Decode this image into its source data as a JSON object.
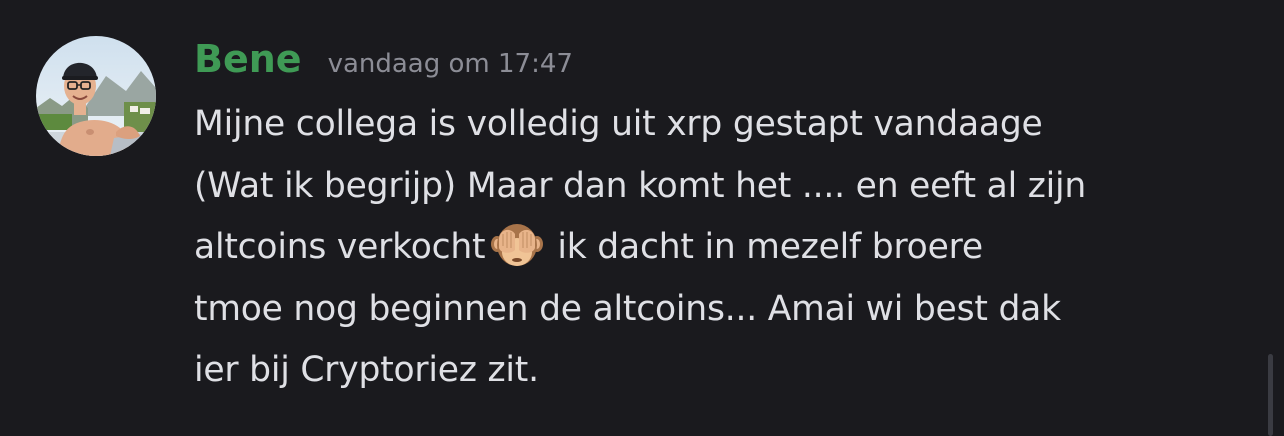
{
  "message": {
    "username": "Bene",
    "timestamp": "vandaag om 17:47",
    "username_color": "#3f9a55",
    "avatar_icon": "user-avatar-photo",
    "lines": {
      "l1": "Mijne collega is volledig uit xrp gestapt vandaage",
      "l2": "(Wat ik begrijp) Maar dan komt het .... en eeft al zijn",
      "l3_before": "altcoins verkocht",
      "l3_emoji": "🙈",
      "l3_after": "ik dacht in mezelf broere",
      "l4": "tmoe nog beginnen de altcoins... Amai wi best dak",
      "l5": "ier bij Cryptoriez zit."
    }
  },
  "theme": {
    "background": "#1a1a1e",
    "text": "#dfe0e5",
    "muted": "#8c8d96"
  }
}
